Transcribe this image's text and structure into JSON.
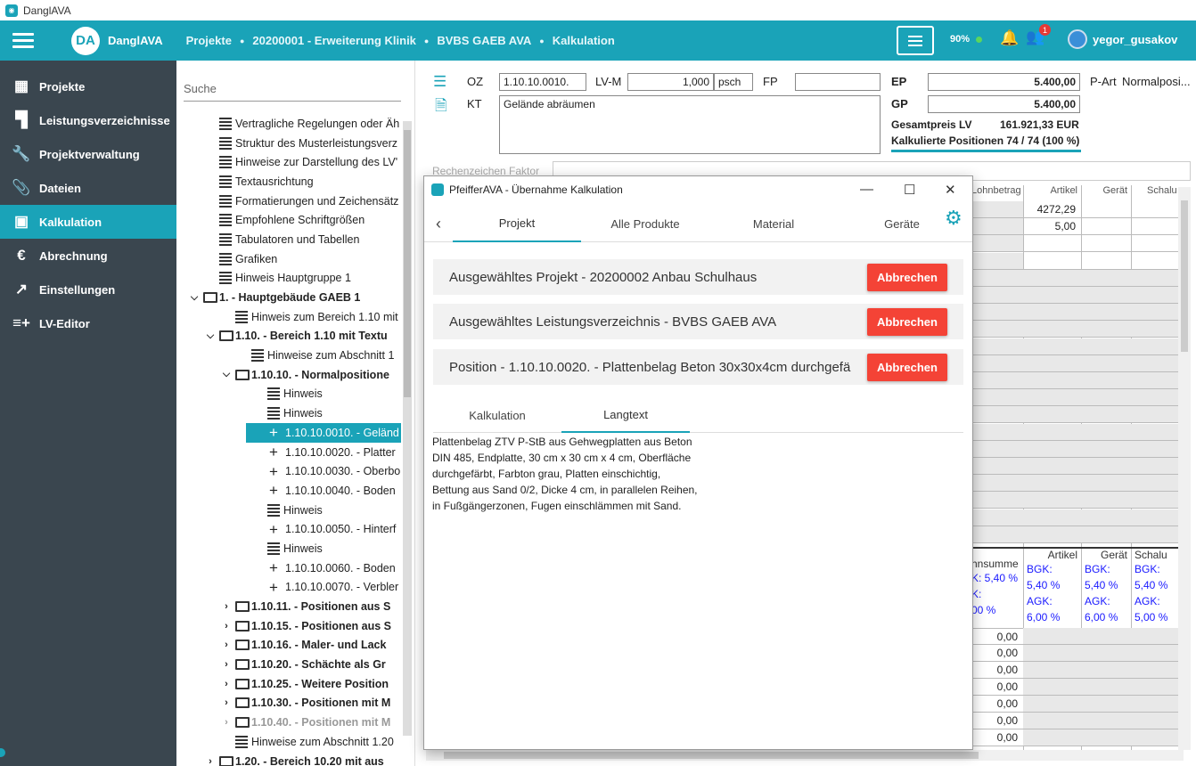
{
  "window": {
    "title": "DanglAVA"
  },
  "topbar": {
    "logo_text": "DA",
    "brand": "DanglAVA",
    "breadcrumbs": [
      "Projekte",
      "20200001 - Erweiterung Klinik",
      "BVBS GAEB AVA",
      "Kalkulation"
    ],
    "percent": "90%",
    "notification_count": "1",
    "username": "yegor_gusakov"
  },
  "sidebar": {
    "items": [
      {
        "label": "Projekte",
        "icon": "building-icon",
        "glyph": "▦"
      },
      {
        "label": "Leistungsverzeichnisse",
        "icon": "tree-icon",
        "glyph": "▜"
      },
      {
        "label": "Projektverwaltung",
        "icon": "wrench-icon",
        "glyph": "🔧"
      },
      {
        "label": "Dateien",
        "icon": "paperclip-icon",
        "glyph": "📎"
      },
      {
        "label": "Kalkulation",
        "icon": "calculator-icon",
        "glyph": "▣",
        "active": true
      },
      {
        "label": "Abrechnung",
        "icon": "euro-icon",
        "glyph": "€"
      },
      {
        "label": "Einstellungen",
        "icon": "trend-icon",
        "glyph": "↗"
      },
      {
        "label": "LV-Editor",
        "icon": "list-add-icon",
        "glyph": "≡+"
      }
    ]
  },
  "tree": {
    "search_placeholder": "Suche",
    "rows": [
      {
        "indent": 48,
        "type": "lines",
        "text": "Vertragliche Regelungen oder Äh"
      },
      {
        "indent": 48,
        "type": "lines",
        "text": "Struktur des Musterleistungsverz"
      },
      {
        "indent": 48,
        "type": "lines",
        "text": "Hinweise zur Darstellung des LV'"
      },
      {
        "indent": 48,
        "type": "lines",
        "text": "Textausrichtung"
      },
      {
        "indent": 48,
        "type": "lines",
        "text": "Formatierungen und Zeichensätz"
      },
      {
        "indent": 48,
        "type": "lines",
        "text": "Empfohlene Schriftgrößen"
      },
      {
        "indent": 48,
        "type": "lines",
        "text": "Tabulatoren und Tabellen"
      },
      {
        "indent": 48,
        "type": "lines",
        "text": "Grafiken"
      },
      {
        "indent": 48,
        "type": "lines",
        "text": "Hinweis Hauptgruppe 1"
      },
      {
        "indent": 30,
        "type": "folder",
        "chev": "⌵",
        "text": "1. - Hauptgebäude GAEB 1",
        "bold": true
      },
      {
        "indent": 66,
        "type": "lines",
        "text": "Hinweis zum Bereich 1.10 mit"
      },
      {
        "indent": 48,
        "type": "folder",
        "chev": "⌵",
        "text": "1.10. - Bereich 1.10 mit Textu",
        "bold": true
      },
      {
        "indent": 84,
        "type": "lines",
        "text": "Hinweise zum Abschnitt 1"
      },
      {
        "indent": 66,
        "type": "folder",
        "chev": "⌵",
        "text": "1.10.10. - Normalpositione",
        "bold": true
      },
      {
        "indent": 102,
        "type": "lines",
        "text": "Hinweis"
      },
      {
        "indent": 102,
        "type": "lines",
        "text": "Hinweis"
      },
      {
        "indent": 102,
        "type": "plus",
        "text": "1.10.10.0010. - Geländ",
        "selected": true
      },
      {
        "indent": 102,
        "type": "plus",
        "text": "1.10.10.0020. - Platter"
      },
      {
        "indent": 102,
        "type": "plus",
        "text": "1.10.10.0030. - Oberbo"
      },
      {
        "indent": 102,
        "type": "plus",
        "text": "1.10.10.0040. - Boden"
      },
      {
        "indent": 102,
        "type": "lines",
        "text": "Hinweis"
      },
      {
        "indent": 102,
        "type": "plus",
        "text": "1.10.10.0050. - Hinterf"
      },
      {
        "indent": 102,
        "type": "lines",
        "text": "Hinweis"
      },
      {
        "indent": 102,
        "type": "plus",
        "text": "1.10.10.0060. - Boden"
      },
      {
        "indent": 102,
        "type": "plus",
        "text": "1.10.10.0070. - Verbler"
      },
      {
        "indent": 66,
        "type": "folder",
        "chev": "›",
        "text": "1.10.11. - Positionen aus S",
        "bold": true
      },
      {
        "indent": 66,
        "type": "folder",
        "chev": "›",
        "text": "1.10.15. - Positionen aus S",
        "bold": true
      },
      {
        "indent": 66,
        "type": "folder",
        "chev": "›",
        "text": "1.10.16. - Maler- und Lack",
        "bold": true
      },
      {
        "indent": 66,
        "type": "folder",
        "chev": "›",
        "text": "1.10.20. - Schächte als Gr",
        "bold": true
      },
      {
        "indent": 66,
        "type": "folder",
        "chev": "›",
        "text": "1.10.25. - Weitere Position",
        "bold": true
      },
      {
        "indent": 66,
        "type": "folder",
        "chev": "›",
        "text": "1.10.30. - Positionen mit M",
        "bold": true
      },
      {
        "indent": 66,
        "type": "folder",
        "chev": "›",
        "text": "1.10.40. - Positionen mit M",
        "bold": true,
        "grey": true
      },
      {
        "indent": 66,
        "type": "lines",
        "text": "Hinweise zum Abschnitt 1.20"
      },
      {
        "indent": 48,
        "type": "folder",
        "chev": "›",
        "text": "1.20. - Bereich 10.20 mit aus",
        "bold": true
      }
    ]
  },
  "position": {
    "oz_label": "OZ",
    "oz_value": "1.10.10.0010.",
    "lvm_label": "LV-M",
    "lvm_value": "1,000",
    "unit": "psch",
    "fp_label": "FP",
    "fp_value": "",
    "ep_label": "EP",
    "ep_value": "5.400,00",
    "part_label": "P-Art",
    "part_value": "Normalposi...",
    "kt_label": "KT",
    "kt_value": "Gelände abräumen",
    "gp_label": "GP",
    "gp_value": "5.400,00",
    "gesamt_label": "Gesamtpreis LV",
    "gesamt_value": "161.921,33 EUR",
    "kalk_positions": "Kalkulierte Positionen 74 / 74 (100 %)",
    "rechenzeichen_placeholder": "Rechenzeichen Faktor"
  },
  "grid": {
    "headers": [
      "Lohnbetrag",
      "Artikel",
      "Gerät",
      "Schalu"
    ],
    "artikel_values": [
      "4272,29",
      "5,00"
    ],
    "summary_headers": [
      "hnsumme",
      "Artikel",
      "Gerät",
      "Schalu"
    ],
    "summary_cols": [
      [
        "K: 5,40 %",
        "K:",
        "00 %"
      ],
      [
        "BGK:",
        "5,40 %",
        "AGK:",
        "6,00 %"
      ],
      [
        "BGK:",
        "5,40 %",
        "AGK:",
        "6,00 %"
      ],
      [
        "BGK:",
        "5,40 %",
        "AGK:",
        "5,00 %"
      ]
    ],
    "zero_values": [
      "0,00",
      "0,00",
      "0,00",
      "0,00",
      "0,00",
      "0,00",
      "0,00"
    ]
  },
  "dialog": {
    "title": "PfeifferAVA - Übernahme Kalkulation",
    "tabs": [
      "Projekt",
      "Alle Produkte",
      "Material",
      "Geräte"
    ],
    "cards": [
      "Ausgewähltes Projekt - 20200002 Anbau Schulhaus",
      "Ausgewähltes Leistungsverzeichnis - BVBS GAEB AVA",
      "Position - 1.10.10.0020. - Plattenbelag Beton 30x30x4cm durchgefä"
    ],
    "abort_label": "Abbrechen",
    "subtabs": [
      "Kalkulation",
      "Langtext"
    ],
    "longtext": [
      "Plattenbelag ZTV P-StB aus Gehwegplatten aus Beton",
      "DIN 485, Endplatte, 30 cm x 30 cm x 4 cm, Oberfläche",
      "durchgefärbt, Farbton grau, Platten einschichtig,",
      "Bettung aus Sand 0/2, Dicke 4 cm, in parallelen Reihen,",
      "in Fußgängerzonen, Fugen einschlämmen mit Sand."
    ]
  },
  "colors": {
    "accent": "#1aa3b8",
    "sidebar": "#3a464f",
    "danger": "#f44336"
  }
}
